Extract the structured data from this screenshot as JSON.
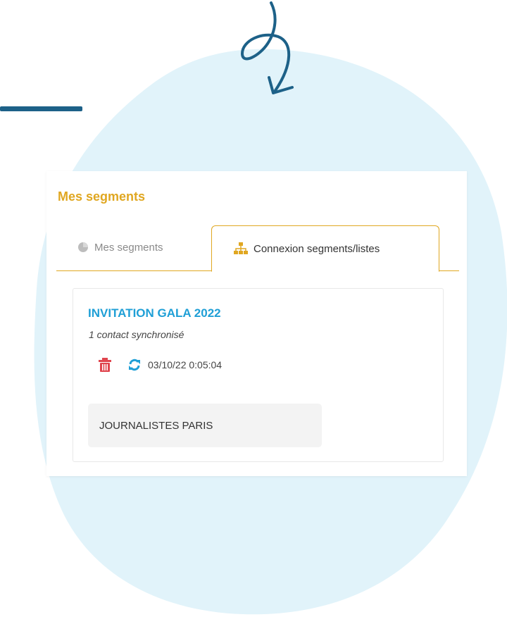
{
  "colors": {
    "accent": "#e0a721",
    "link": "#1f9fd6",
    "danger": "#e0454e",
    "blob": "#e1f3fa",
    "decoration": "#1d6188"
  },
  "panel": {
    "title": "Mes segments",
    "tabs": [
      {
        "label": "Mes segments",
        "icon": "pie-chart-icon",
        "active": false
      },
      {
        "label": "Connexion segments/listes",
        "icon": "sitemap-icon",
        "active": true
      }
    ]
  },
  "segment_card": {
    "title": "INVITATION GALA 2022",
    "subtitle": "1 contact synchronisé",
    "delete_icon": "trash-icon",
    "sync_icon": "refresh-icon",
    "timestamp": "03/10/22 0:05:04",
    "list_chip": "JOURNALISTES PARIS"
  }
}
